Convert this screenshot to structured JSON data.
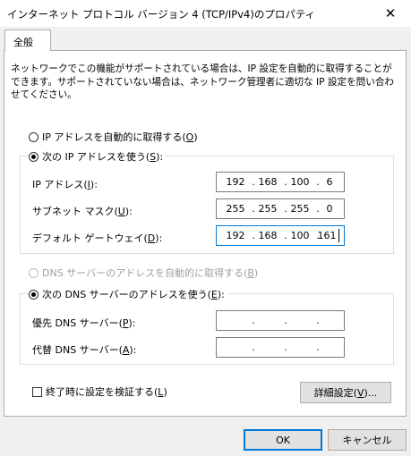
{
  "window": {
    "title": "インターネット プロトコル バージョン 4 (TCP/IPv4)のプロパティ",
    "close_glyph": "✕"
  },
  "tab": {
    "label": "全般"
  },
  "description": "ネットワークでこの機能がサポートされている場合は、IP 設定を自動的に取得することができます。サポートされていない場合は、ネットワーク管理者に適切な IP 設定を問い合わせてください。",
  "ip": {
    "auto_label": "IP アドレスを自動的に取得する(",
    "auto_key": "O",
    "manual_label": "次の IP アドレスを使う(",
    "manual_key": "S",
    "address_label": "IP アドレス(",
    "address_key": "I",
    "address": [
      "192",
      "168",
      "100",
      "6"
    ],
    "subnet_label": "サブネット マスク(",
    "subnet_key": "U",
    "subnet": [
      "255",
      "255",
      "255",
      "0"
    ],
    "gateway_label": "デフォルト ゲートウェイ(",
    "gateway_key": "D",
    "gateway": [
      "192",
      "168",
      "100",
      "161"
    ]
  },
  "dns": {
    "auto_label": "DNS サーバーのアドレスを自動的に取得する(",
    "auto_key": "B",
    "manual_label": "次の DNS サーバーのアドレスを使う(",
    "manual_key": "E",
    "preferred_label": "優先 DNS サーバー(",
    "preferred_key": "P",
    "preferred": [
      "",
      "",
      "",
      ""
    ],
    "alternate_label": "代替 DNS サーバー(",
    "alternate_key": "A",
    "alternate": [
      "",
      "",
      "",
      ""
    ]
  },
  "validate": {
    "label": "終了時に設定を検証する(",
    "key": "L"
  },
  "buttons": {
    "advanced_label": "詳細設定(",
    "advanced_key": "V",
    "advanced_suffix": ")...",
    "ok": "OK",
    "cancel": "キャンセル"
  },
  "closing_paren": "):",
  "closing_paren_plain": ")",
  "dot": "."
}
